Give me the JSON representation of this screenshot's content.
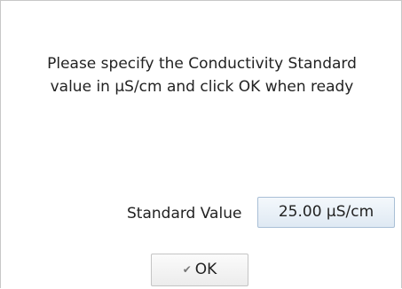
{
  "dialog": {
    "message_line1": "Please specify the Conductivity Standard",
    "message_line2": "value in µS/cm and click OK when ready",
    "field_label": "Standard Value",
    "field_value": "25.00 µS/cm",
    "ok_label": "OK",
    "ok_icon": "check-icon"
  }
}
